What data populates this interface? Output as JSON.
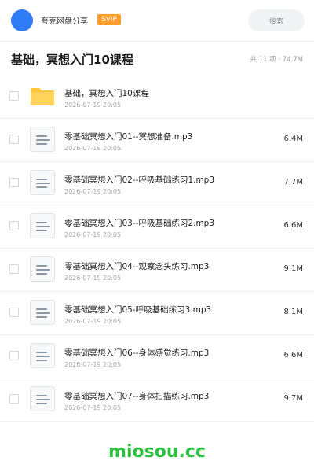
{
  "header": {
    "account_name": "夸克网盘分享",
    "badge": "SVIP",
    "search_placeholder": "搜索"
  },
  "title_bar": {
    "title": "基础，冥想入门10课程",
    "meta": "共 11 项 · 74.7M"
  },
  "files": [
    {
      "type": "folder",
      "name": "基础，冥想入门10课程",
      "date": "2026-07-19 20:05",
      "size": ""
    },
    {
      "type": "file",
      "name": "零基础冥想入门01--冥想准备.mp3",
      "date": "2026-07-19 20:05",
      "size": "6.4M"
    },
    {
      "type": "file",
      "name": "零基础冥想入门02--呼吸基础练习1.mp3",
      "date": "2026-07-19 20:05",
      "size": "7.7M"
    },
    {
      "type": "file",
      "name": "零基础冥想入门03--呼吸基础练习2.mp3",
      "date": "2026-07-19 20:05",
      "size": "6.6M"
    },
    {
      "type": "file",
      "name": "零基础冥想入门04--观察念头练习.mp3",
      "date": "2026-07-19 20:05",
      "size": "9.1M"
    },
    {
      "type": "file",
      "name": "零基础冥想入门05-呼吸基础练习3.mp3",
      "date": "2026-07-19 20:05",
      "size": "8.1M"
    },
    {
      "type": "file",
      "name": "零基础冥想入门06--身体感觉练习.mp3",
      "date": "2026-07-19 20:05",
      "size": "6.6M"
    },
    {
      "type": "file",
      "name": "零基础冥想入门07--身体扫描练习.mp3",
      "date": "2026-07-19 20:05",
      "size": "9.7M"
    }
  ],
  "watermark": "miosou.cc",
  "colors": {
    "avatar": "#2f7cf6",
    "svip": "#ff9c2a",
    "folder": "#ffc53d",
    "watermark": "#2fbf41"
  }
}
